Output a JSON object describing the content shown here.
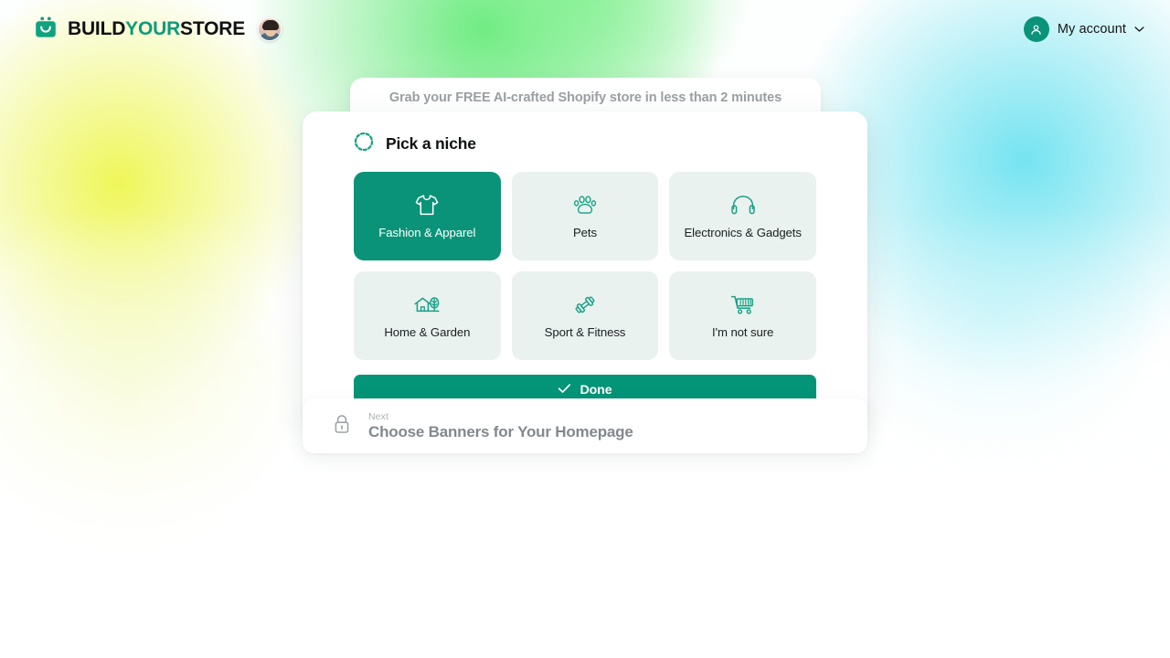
{
  "header": {
    "brand": {
      "logo_icon": "shopping-bag-smile-icon",
      "text_part1": "BUILD",
      "text_part2": "YOUR",
      "text_part3": "STORE",
      "accent_color": "#0f9b7a",
      "avatar_icon": "user-photo-avatar"
    },
    "account": {
      "icon": "user-circle-icon",
      "label": "My account",
      "chevron": "chevron-down-icon"
    }
  },
  "promo": {
    "text": "Grab your FREE AI-crafted Shopify store in less than 2 minutes"
  },
  "niche_step": {
    "status_icon": "dashed-circle-icon",
    "title": "Pick a niche",
    "tiles": [
      {
        "label": "Fashion & Apparel",
        "icon": "tshirt-icon",
        "selected": true
      },
      {
        "label": "Pets",
        "icon": "paw-icon",
        "selected": false
      },
      {
        "label": "Electronics & Gadgets",
        "icon": "headphones-icon",
        "selected": false
      },
      {
        "label": "Home & Garden",
        "icon": "house-tree-icon",
        "selected": false
      },
      {
        "label": "Sport & Fitness",
        "icon": "dumbbell-icon",
        "selected": false
      },
      {
        "label": "I'm not sure",
        "icon": "shopping-cart-icon",
        "selected": false
      }
    ],
    "done_button": {
      "label": "Done",
      "icon": "check-icon",
      "color": "#049478"
    }
  },
  "next_step": {
    "lock_icon": "lock-icon",
    "eyebrow": "Next",
    "title": "Choose Banners for Your Homepage"
  },
  "theme": {
    "brand_teal": "#0a9378",
    "tile_bg": "#e9f2ee",
    "muted_text": "#9b9fa3"
  }
}
